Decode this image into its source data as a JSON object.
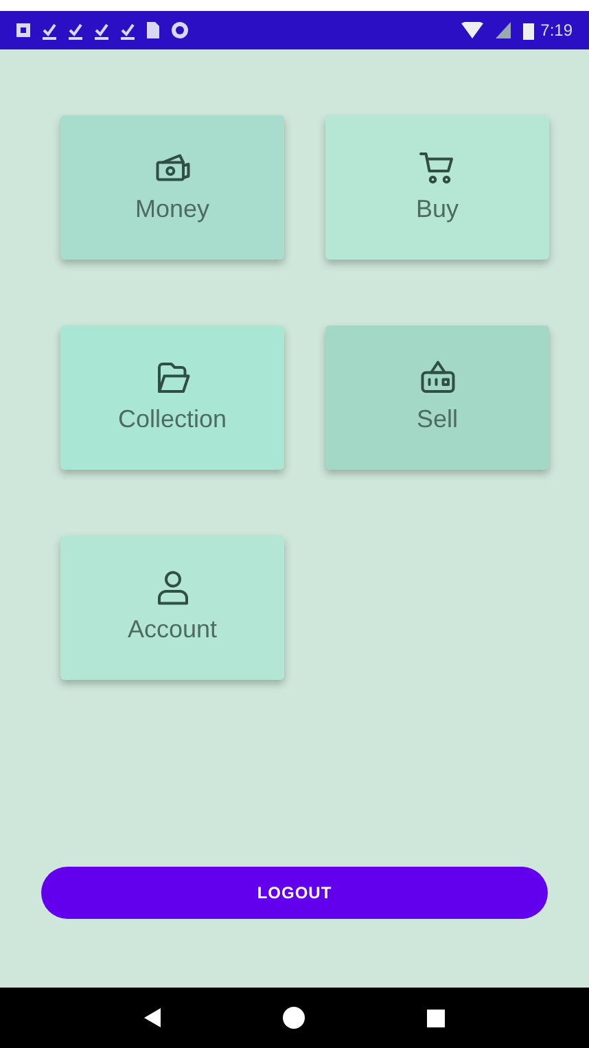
{
  "status_bar": {
    "time": "7:19"
  },
  "tiles": [
    {
      "kind": "money",
      "label": "Money",
      "color": "#a8dccd"
    },
    {
      "kind": "cart",
      "label": "Buy",
      "color": "#b6e6d4"
    },
    {
      "kind": "collection",
      "label": "Collection",
      "color": "#a9e6d3"
    },
    {
      "kind": "sell",
      "label": "Sell",
      "color": "#a4d8c6"
    },
    {
      "kind": "account",
      "label": "Account",
      "color": "#b3e6d4"
    }
  ],
  "logout_button": {
    "label": "LOGOUT"
  }
}
